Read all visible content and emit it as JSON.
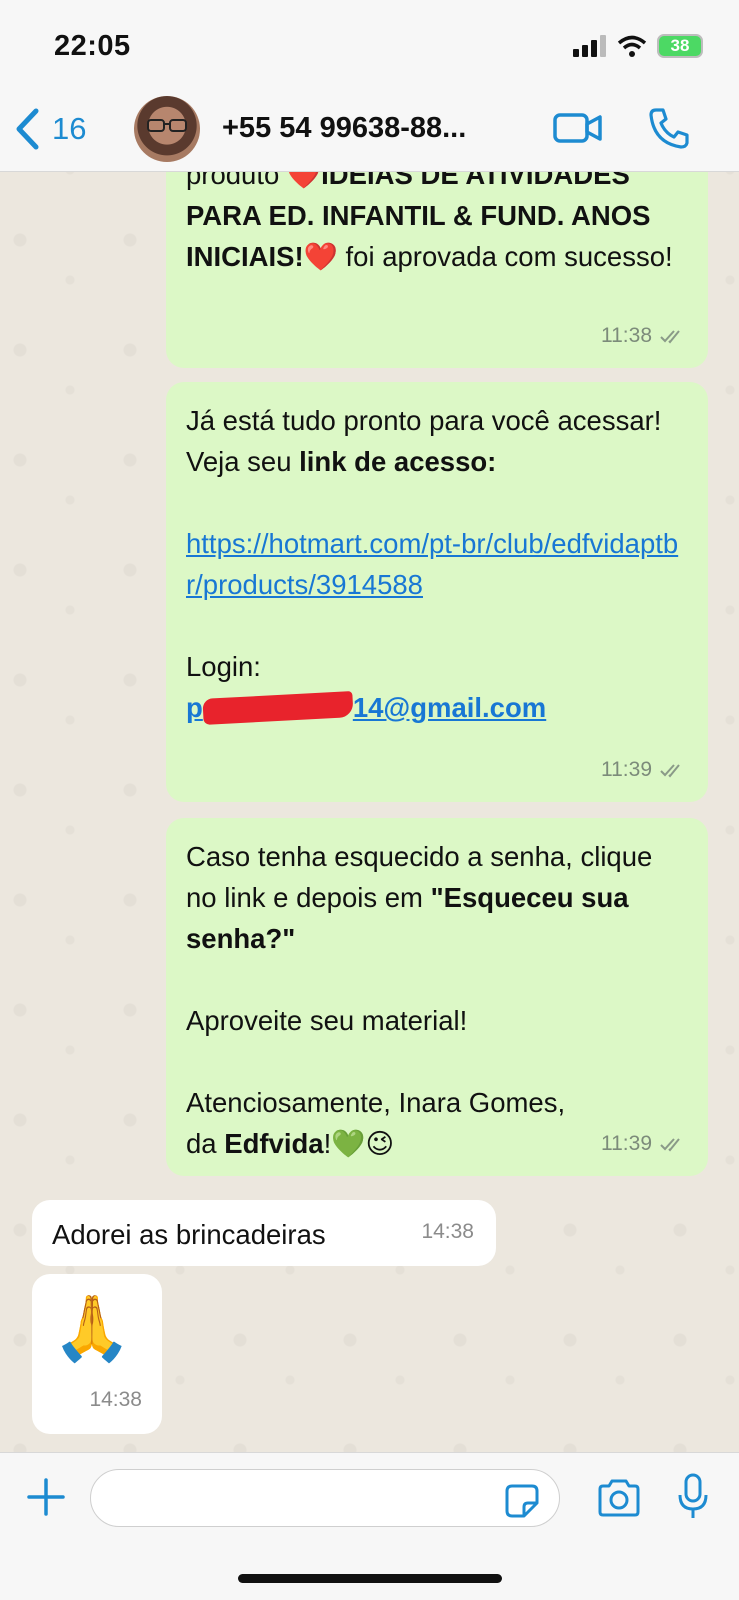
{
  "status_bar": {
    "time": "22:05",
    "battery": "38"
  },
  "header": {
    "back_count": "16",
    "contact_name": "+55 54 99638-88..."
  },
  "messages": [
    {
      "line1_pre": "produto ",
      "line1_bold": "IDEIAS DE ATIVIDADES PARA ED. INFANTIL & FUND. ANOS INICIAIS!",
      "line1_post": " foi aprovada com sucesso!",
      "time": "11:38"
    },
    {
      "text1": "Já está tudo pronto para você acessar! Veja seu ",
      "text1_bold": "link de acesso:",
      "link": "https://hotmart.com/pt-br/club/edfvidaptbr/products/3914588",
      "login_label": "Login:",
      "email_start": "p",
      "email_end": "14@gmail.com",
      "time": "11:39"
    },
    {
      "text1": "Caso tenha esquecido a senha, clique no link e depois em ",
      "text1_bold": "\"Esqueceu sua senha?\"",
      "text2": "Aproveite seu material!",
      "text3": "Atenciosamente, Inara Gomes, da ",
      "text3_bold": "Edfvida",
      "text3_end": "!",
      "time": "11:39"
    },
    {
      "text": "Adorei as brincadeiras",
      "time": "14:38"
    },
    {
      "emoji": "🙏",
      "time": "14:38"
    }
  ],
  "icons": {
    "back": "chevron-left-icon",
    "video": "video-camera-icon",
    "call": "phone-icon",
    "plus": "plus-icon",
    "sticker": "sticker-icon",
    "camera": "camera-icon",
    "mic": "microphone-icon",
    "read": "double-check-icon"
  },
  "colors": {
    "accent": "#1d8bd1",
    "outgoing_bubble": "#dcf8c6",
    "link": "#1877d4",
    "battery": "#4cd964"
  }
}
